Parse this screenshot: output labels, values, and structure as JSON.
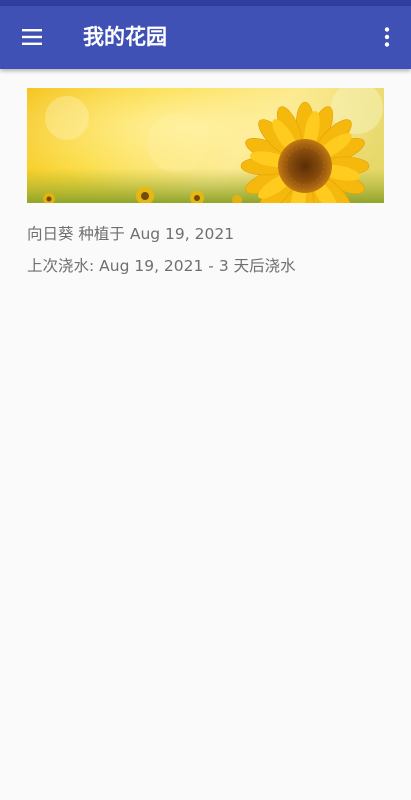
{
  "app_bar": {
    "title": "我的花园",
    "nav_icon": "menu-icon",
    "overflow_icon": "more-vert-icon"
  },
  "colors": {
    "primary": "#3f51b5",
    "primary_dark": "#303f9f",
    "background": "#fafafa",
    "secondary_text": "#6f6f6f"
  },
  "garden": {
    "plants": [
      {
        "image": "sunflower-photo",
        "planted_text": "向日葵 种植于 Aug 19, 2021",
        "watered_text": "上次浇水: Aug 19, 2021 - 3 天后浇水"
      }
    ]
  }
}
